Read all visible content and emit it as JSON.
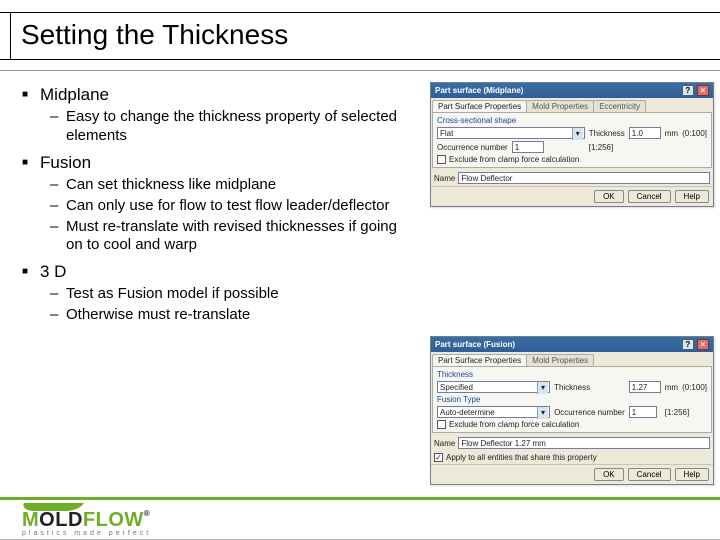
{
  "title": "Setting the Thickness",
  "bullets": [
    {
      "label": "Midplane",
      "sub": [
        "Easy to change the thickness property of selected elements"
      ]
    },
    {
      "label": "Fusion",
      "sub": [
        "Can set thickness like midplane",
        "Can only use for flow to test flow leader/deflector",
        "Must re-translate with revised thicknesses if going on to cool and warp"
      ]
    },
    {
      "label": "3 D",
      "sub": [
        "Test as Fusion model if possible",
        "Otherwise must re-translate"
      ]
    }
  ],
  "dialog1": {
    "title": "Part surface (Midplane)",
    "tabs": [
      "Part Surface Properties",
      "Mold Properties",
      "Eccentricity"
    ],
    "row1": {
      "label": "Cross-sectional shape"
    },
    "row2": {
      "shape_value": "Flat",
      "thick_label": "Thickness",
      "thick_value": "1.0",
      "unit": "mm",
      "range": "(0:100]"
    },
    "row3": {
      "label": "Occurrence number",
      "value": "1",
      "range": "[1:256]"
    },
    "exclude": "Exclude from clamp force calculation",
    "name_label": "Name",
    "name_value": "Flow Deflector",
    "buttons": {
      "ok": "OK",
      "cancel": "Cancel",
      "help": "Help"
    }
  },
  "dialog2": {
    "title": "Part surface (Fusion)",
    "tabs": [
      "Part Surface Properties",
      "Mold Properties"
    ],
    "row1": {
      "label": "Thickness",
      "value": "Specified",
      "thick_label": "Thickness",
      "thick_value": "1.27",
      "unit": "mm",
      "range": "(0:100]"
    },
    "row2": {
      "label": "Fusion Type"
    },
    "row3": {
      "value": "Auto-determine",
      "occ_label": "Occurrence number",
      "occ_value": "1",
      "occ_range": "[1:256]"
    },
    "exclude": "Exclude from clamp force calculation",
    "name_label": "Name",
    "name_value": "Flow Deflector 1.27 mm",
    "apply": "Apply to all entities that share this property",
    "buttons": {
      "ok": "OK",
      "cancel": "Cancel",
      "help": "Help"
    }
  },
  "logo": {
    "brand1": "M",
    "brand2": "OLD",
    "brand3": "FLOW",
    "reg": "®",
    "tagline": "plastics made perfect"
  }
}
